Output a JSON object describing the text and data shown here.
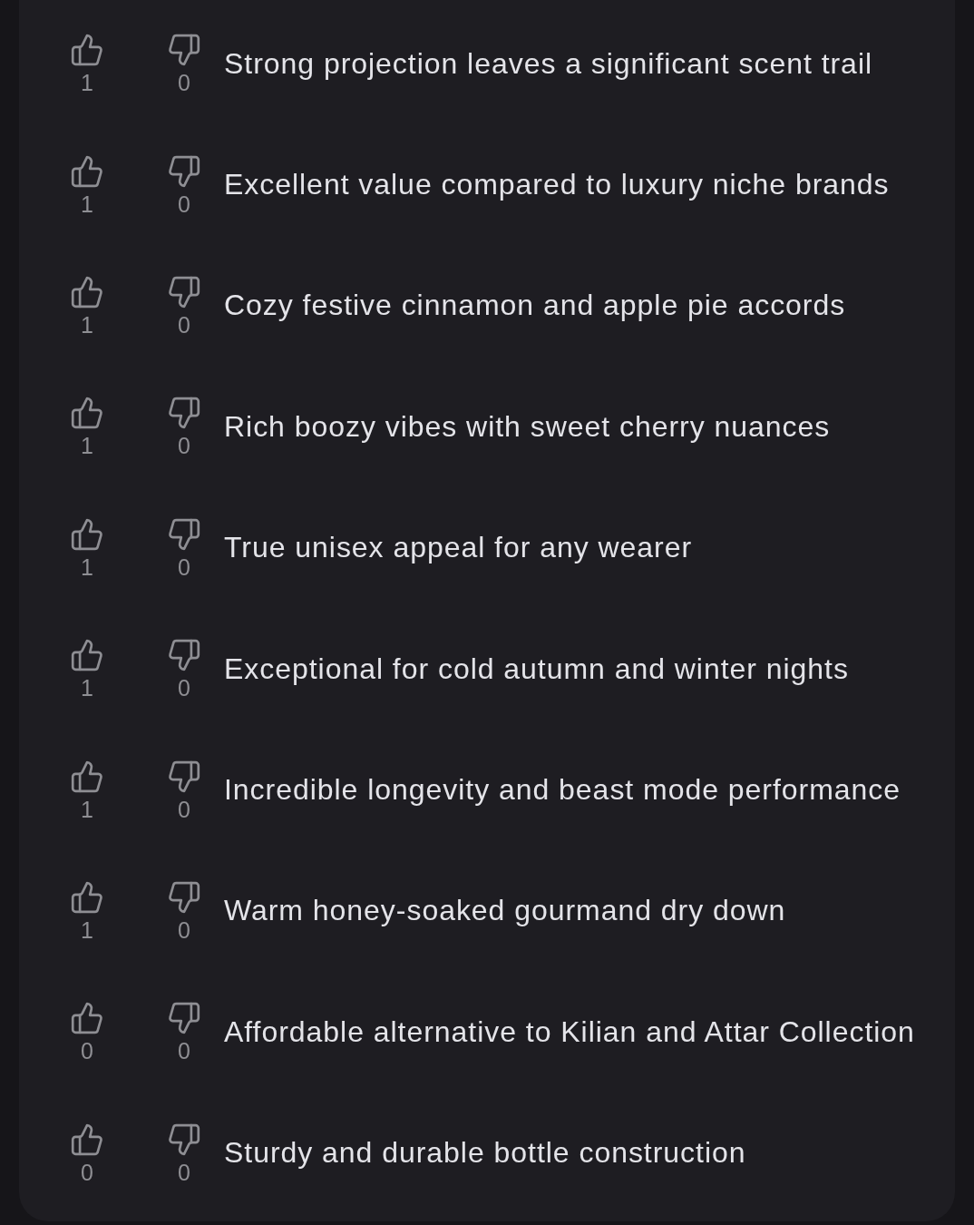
{
  "items": [
    {
      "upvotes": "1",
      "downvotes": "0",
      "text": "Strong projection leaves a significant scent trail"
    },
    {
      "upvotes": "1",
      "downvotes": "0",
      "text": "Excellent value compared to luxury niche brands"
    },
    {
      "upvotes": "1",
      "downvotes": "0",
      "text": "Cozy festive cinnamon and apple pie accords"
    },
    {
      "upvotes": "1",
      "downvotes": "0",
      "text": "Rich boozy vibes with sweet cherry nuances"
    },
    {
      "upvotes": "1",
      "downvotes": "0",
      "text": "True unisex appeal for any wearer"
    },
    {
      "upvotes": "1",
      "downvotes": "0",
      "text": "Exceptional for cold autumn and winter nights"
    },
    {
      "upvotes": "1",
      "downvotes": "0",
      "text": "Incredible longevity and beast mode performance"
    },
    {
      "upvotes": "1",
      "downvotes": "0",
      "text": "Warm honey-soaked gourmand dry down"
    },
    {
      "upvotes": "0",
      "downvotes": "0",
      "text": "Affordable alternative to Kilian and Attar Collection"
    },
    {
      "upvotes": "0",
      "downvotes": "0",
      "text": "Sturdy and durable bottle construction"
    }
  ]
}
